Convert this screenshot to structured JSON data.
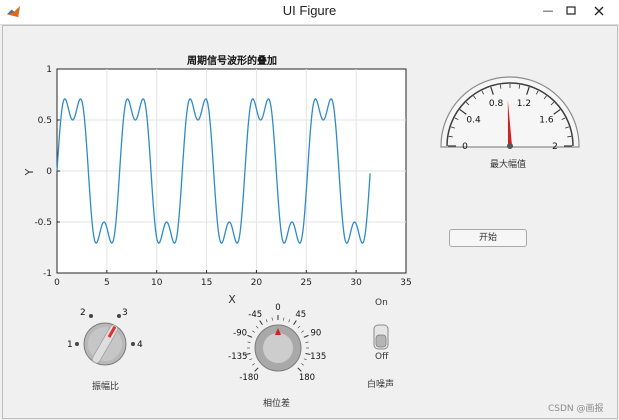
{
  "window": {
    "title": "UI Figure"
  },
  "plot": {
    "title": "周期信号波形的叠加",
    "xlabel": "X",
    "ylabel": "Y",
    "x_ticks": [
      "0",
      "5",
      "10",
      "15",
      "20",
      "25",
      "30",
      "35"
    ],
    "y_ticks": [
      "1",
      "0.5",
      "0",
      "-0.5",
      "-1"
    ]
  },
  "chart_data": {
    "type": "line",
    "title": "周期信号波形的叠加",
    "xlabel": "X",
    "ylabel": "Y",
    "xlim": [
      0,
      35
    ],
    "ylim": [
      -1,
      1
    ],
    "grid": true,
    "series": [
      {
        "x_range": [
          0,
          31.4
        ],
        "formula": "0.75*sin(x) + 0.25*sin(3x)",
        "x": [
          0,
          0.79,
          1.05,
          1.57,
          2.09,
          2.36,
          3.14,
          3.93,
          4.19,
          4.71,
          5.24,
          5.5,
          6.28,
          31.4
        ],
        "values": [
          0,
          0.61,
          0.65,
          0.5,
          0.65,
          0.61,
          0,
          -0.61,
          -0.65,
          -0.5,
          -0.65,
          -0.61,
          0,
          0
        ]
      }
    ]
  },
  "gauge": {
    "label": "最大幅值",
    "ticks": [
      "0",
      "0.4",
      "0.8",
      "1.2",
      "1.6",
      "2"
    ],
    "min": 0,
    "max": 2,
    "value": 0.97
  },
  "amplitude_knob": {
    "label": "振幅比",
    "options": [
      "1",
      "2",
      "3",
      "4"
    ],
    "selected": "3"
  },
  "phase_knob": {
    "label": "相位差",
    "ticks": [
      "-180",
      "-135",
      "-90",
      "-45",
      "0",
      "45",
      "90",
      "135",
      "180"
    ],
    "value": 0
  },
  "noise_switch": {
    "label": "白噪声",
    "on_label": "On",
    "off_label": "Off",
    "state": "Off"
  },
  "start_button": {
    "label": "开始"
  },
  "watermark": "CSDN @画报"
}
